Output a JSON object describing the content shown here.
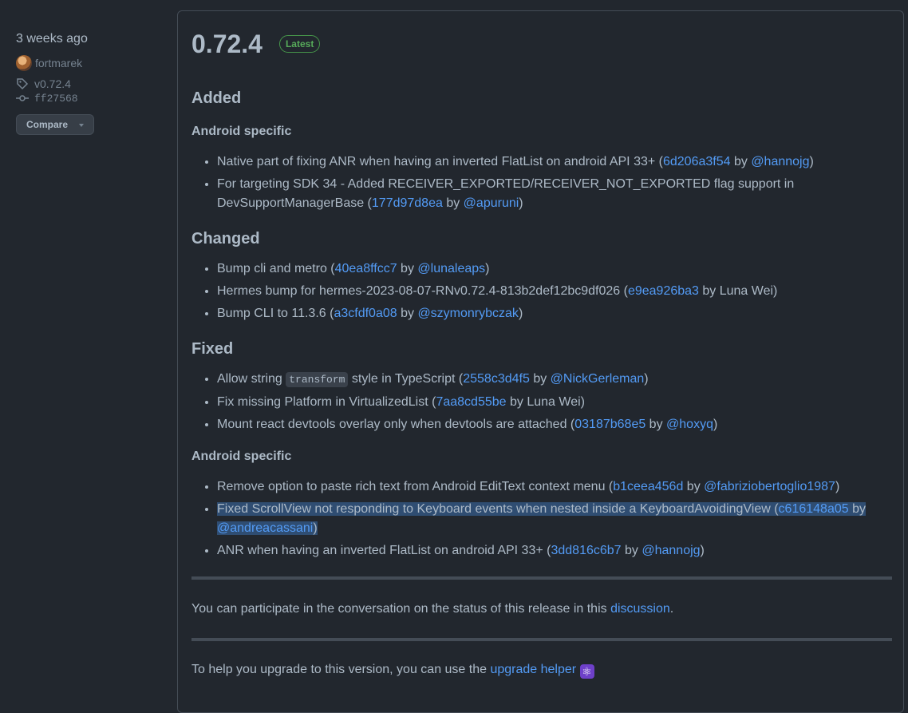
{
  "sidebar": {
    "date": "3 weeks ago",
    "author": "fortmarek",
    "tag": "v0.72.4",
    "commit": "ff27568",
    "compare": "Compare"
  },
  "release": {
    "version": "0.72.4",
    "badge": "Latest"
  },
  "added": {
    "heading": "Added",
    "sub": "Android specific",
    "items": [
      {
        "pre": "Native part of fixing ANR when having an inverted FlatList on android API 33+ (",
        "hash": "6d206a3f54",
        "by": " by ",
        "user": "@hannojg",
        "post": ")"
      },
      {
        "pre": "For targeting SDK 34 - Added RECEIVER_EXPORTED/RECEIVER_NOT_EXPORTED flag support in DevSupportManagerBase (",
        "hash": "177d97d8ea",
        "by": " by ",
        "user": "@apuruni",
        "post": ")"
      }
    ]
  },
  "changed": {
    "heading": "Changed",
    "items": [
      {
        "pre": "Bump cli and metro (",
        "hash": "40ea8ffcc7",
        "by": " by ",
        "user": "@lunaleaps",
        "post": ")"
      },
      {
        "pre": "Hermes bump for hermes-2023-08-07-RNv0.72.4-813b2def12bc9df026 (",
        "hash": "e9ea926ba3",
        "by": " by Luna Wei)"
      },
      {
        "pre": "Bump CLI to 11.3.6 (",
        "hash": "a3cfdf0a08",
        "by": " by ",
        "user": "@szymonrybczak",
        "post": ")"
      }
    ]
  },
  "fixed": {
    "heading": "Fixed",
    "items": [
      {
        "pre": "Allow string ",
        "code": "transform",
        "mid": " style in TypeScript (",
        "hash": "2558c3d4f5",
        "by": " by ",
        "user": "@NickGerleman",
        "post": ")"
      },
      {
        "pre": "Fix missing Platform in VirtualizedList (",
        "hash": "7aa8cd55be",
        "by": " by Luna Wei)"
      },
      {
        "pre": "Mount react devtools overlay only when devtools are attached (",
        "hash": "03187b68e5",
        "by": " by ",
        "user": "@hoxyq",
        "post": ")"
      }
    ],
    "sub": "Android specific",
    "android_items": [
      {
        "pre": "Remove option to paste rich text from Android EditText context menu (",
        "hash": "b1ceea456d",
        "by": " by ",
        "user": "@fabriziobertoglio1987",
        "post": ")"
      },
      {
        "pre": "Fixed ScrollView not responding to Keyboard events when nested inside a KeyboardAvoidingView (",
        "hash": "c616148a05",
        "by": " by ",
        "user": "@andreacassani",
        "post": ")"
      },
      {
        "pre": "ANR when having an inverted FlatList on android API 33+ (",
        "hash": "3dd816c6b7",
        "by": " by ",
        "user": "@hannojg",
        "post": ")"
      }
    ]
  },
  "discussion": {
    "pre": "You can participate in the conversation on the status of this release in this ",
    "link": "discussion",
    "post": "."
  },
  "upgrade": {
    "pre": "To help you upgrade to this version, you can use the ",
    "link": "upgrade helper",
    "emoji": "⚛"
  },
  "colors": {
    "background": "#22272e",
    "link": "#539bf5",
    "badge": "#57ab5a",
    "selection": "#2f4d72"
  }
}
